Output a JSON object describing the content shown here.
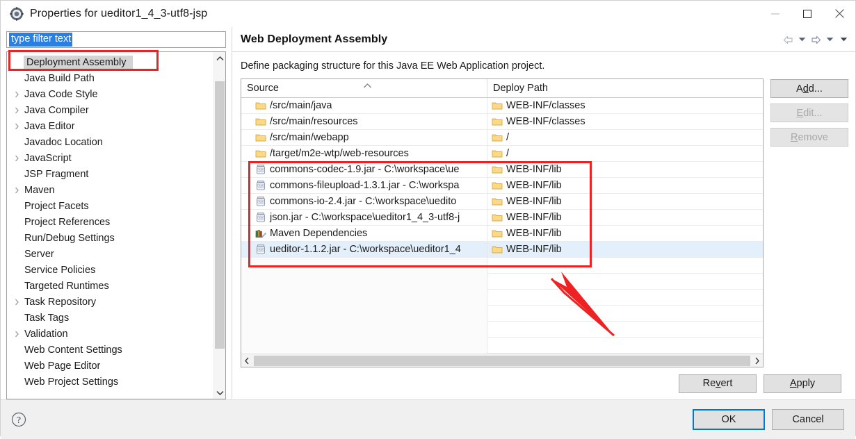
{
  "window": {
    "title": "Properties for ueditor1_4_3-utf8-jsp",
    "icon": "properties-gear-icon",
    "minimize_label": "Minimize",
    "maximize_label": "Maximize",
    "close_label": "Close"
  },
  "sidebar": {
    "filter": {
      "value": "type filter text",
      "placeholder": "type filter text"
    },
    "items": [
      {
        "label": "Deployment Assembly",
        "expandable": false,
        "selected": true
      },
      {
        "label": "Java Build Path",
        "expandable": false,
        "selected": false
      },
      {
        "label": "Java Code Style",
        "expandable": true,
        "selected": false
      },
      {
        "label": "Java Compiler",
        "expandable": true,
        "selected": false
      },
      {
        "label": "Java Editor",
        "expandable": true,
        "selected": false
      },
      {
        "label": "Javadoc Location",
        "expandable": false,
        "selected": false
      },
      {
        "label": "JavaScript",
        "expandable": true,
        "selected": false
      },
      {
        "label": "JSP Fragment",
        "expandable": false,
        "selected": false
      },
      {
        "label": "Maven",
        "expandable": true,
        "selected": false
      },
      {
        "label": "Project Facets",
        "expandable": false,
        "selected": false
      },
      {
        "label": "Project References",
        "expandable": false,
        "selected": false
      },
      {
        "label": "Run/Debug Settings",
        "expandable": false,
        "selected": false
      },
      {
        "label": "Server",
        "expandable": false,
        "selected": false
      },
      {
        "label": "Service Policies",
        "expandable": false,
        "selected": false
      },
      {
        "label": "Targeted Runtimes",
        "expandable": false,
        "selected": false
      },
      {
        "label": "Task Repository",
        "expandable": true,
        "selected": false
      },
      {
        "label": "Task Tags",
        "expandable": false,
        "selected": false
      },
      {
        "label": "Validation",
        "expandable": true,
        "selected": false
      },
      {
        "label": "Web Content Settings",
        "expandable": false,
        "selected": false
      },
      {
        "label": "Web Page Editor",
        "expandable": false,
        "selected": false
      },
      {
        "label": "Web Project Settings",
        "expandable": false,
        "selected": false
      }
    ]
  },
  "page": {
    "title": "Web Deployment Assembly",
    "description": "Define packaging structure for this Java EE Web Application project.",
    "nav": {
      "back": "back-arrow",
      "back_menu": "back-dropdown",
      "forward": "forward-arrow",
      "forward_menu": "forward-dropdown",
      "view_menu": "view-menu"
    }
  },
  "table": {
    "columns": [
      {
        "label": "Source",
        "sort": "ascending"
      },
      {
        "label": "Deploy Path",
        "sort": "none"
      }
    ],
    "rows": [
      {
        "icon": "folder-icon",
        "source": "/src/main/java",
        "deploy_icon": "folder-icon",
        "deploy": "WEB-INF/classes",
        "selected": false
      },
      {
        "icon": "folder-icon",
        "source": "/src/main/resources",
        "deploy_icon": "folder-icon",
        "deploy": "WEB-INF/classes",
        "selected": false
      },
      {
        "icon": "folder-icon",
        "source": "/src/main/webapp",
        "deploy_icon": "folder-icon",
        "deploy": "/",
        "selected": false
      },
      {
        "icon": "folder-icon",
        "source": "/target/m2e-wtp/web-resources",
        "deploy_icon": "folder-icon",
        "deploy": "/",
        "selected": false
      },
      {
        "icon": "jar-icon",
        "source": "commons-codec-1.9.jar - C:\\workspace\\ue",
        "deploy_icon": "folder-icon",
        "deploy": "WEB-INF/lib",
        "selected": false
      },
      {
        "icon": "jar-icon",
        "source": "commons-fileupload-1.3.1.jar - C:\\workspa",
        "deploy_icon": "folder-icon",
        "deploy": "WEB-INF/lib",
        "selected": false
      },
      {
        "icon": "jar-icon",
        "source": "commons-io-2.4.jar - C:\\workspace\\uedito",
        "deploy_icon": "folder-icon",
        "deploy": "WEB-INF/lib",
        "selected": false
      },
      {
        "icon": "jar-icon",
        "source": "json.jar - C:\\workspace\\ueditor1_4_3-utf8-j",
        "deploy_icon": "folder-icon",
        "deploy": "WEB-INF/lib",
        "selected": false
      },
      {
        "icon": "library-icon",
        "source": "Maven Dependencies",
        "deploy_icon": "folder-icon",
        "deploy": "WEB-INF/lib",
        "selected": false
      },
      {
        "icon": "jar-icon",
        "source": "ueditor-1.1.2.jar - C:\\workspace\\ueditor1_4",
        "deploy_icon": "folder-icon",
        "deploy": "WEB-INF/lib",
        "selected": true
      }
    ],
    "blank_row_count": 6,
    "hscroll": {
      "left_arrow": "chevron-left-icon",
      "right_arrow": "chevron-right-icon"
    }
  },
  "side_buttons": [
    {
      "label": "Add...",
      "mnemonic": "d",
      "enabled": true
    },
    {
      "label": "Edit...",
      "mnemonic": "E",
      "enabled": false
    },
    {
      "label": "Remove",
      "mnemonic": "R",
      "enabled": false
    }
  ],
  "apply_buttons": [
    {
      "label": "Revert",
      "mnemonic": "v",
      "enabled": true
    },
    {
      "label": "Apply",
      "mnemonic": "A",
      "enabled": true
    }
  ],
  "footer": {
    "help_icon": "help-question-icon",
    "buttons": [
      {
        "label": "OK",
        "default": true
      },
      {
        "label": "Cancel",
        "default": false
      }
    ]
  },
  "annotations": {
    "highlight_color": "#ee2222",
    "boxes": [
      {
        "name": "sidebar-deployment-assembly-highlight"
      },
      {
        "name": "jar-entries-highlight"
      }
    ],
    "arrow": {
      "name": "pointer-arrow",
      "direction": "up-left"
    }
  },
  "colors": {
    "accent": "#0078d7",
    "selection": "#2a7fe0",
    "row_selection": "#e3effb",
    "annotation": "#ee2222"
  }
}
